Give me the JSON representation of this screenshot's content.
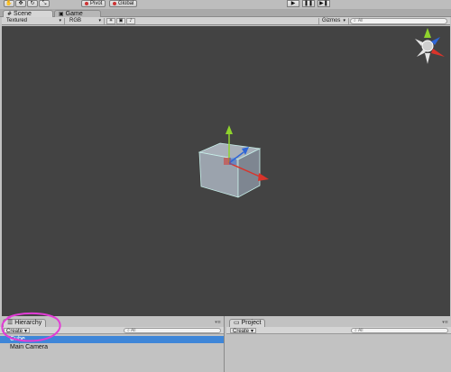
{
  "toolbar": {
    "tools": [
      {
        "icon": "hand-icon",
        "glyph": "✋"
      },
      {
        "icon": "move-icon",
        "glyph": "✥"
      },
      {
        "icon": "rotate-icon",
        "glyph": "↻"
      },
      {
        "icon": "scale-icon",
        "glyph": "⤡"
      }
    ],
    "pivot_label": "Pivot",
    "global_label": "Global",
    "play_glyph": "▶",
    "pause_glyph": "❚❚",
    "step_glyph": "▶❚"
  },
  "tabs": [
    {
      "label": "Scene",
      "icon": "scene-icon",
      "glyph": "#",
      "active": true
    },
    {
      "label": "Game",
      "icon": "game-icon",
      "glyph": "▣",
      "active": false
    }
  ],
  "scene_bar": {
    "shading": "Textured",
    "render_mode": "RGB",
    "gizmos": "Gizmos",
    "search_placeholder": "All",
    "search_glyph": "⌕"
  },
  "hierarchy": {
    "title": "Hierarchy",
    "create_label": "Create",
    "search_placeholder": "All",
    "items": [
      {
        "label": "Cube",
        "selected": true
      },
      {
        "label": "Main Camera",
        "selected": false
      }
    ]
  },
  "project": {
    "title": "Project",
    "create_label": "Create",
    "search_placeholder": "All"
  },
  "colors": {
    "viewport_bg": "#434343",
    "selection": "#3e86d8",
    "annotation": "#e23cd6",
    "axis_x": "#d9342b",
    "axis_y": "#8fd32c",
    "axis_z": "#2f66d6"
  }
}
